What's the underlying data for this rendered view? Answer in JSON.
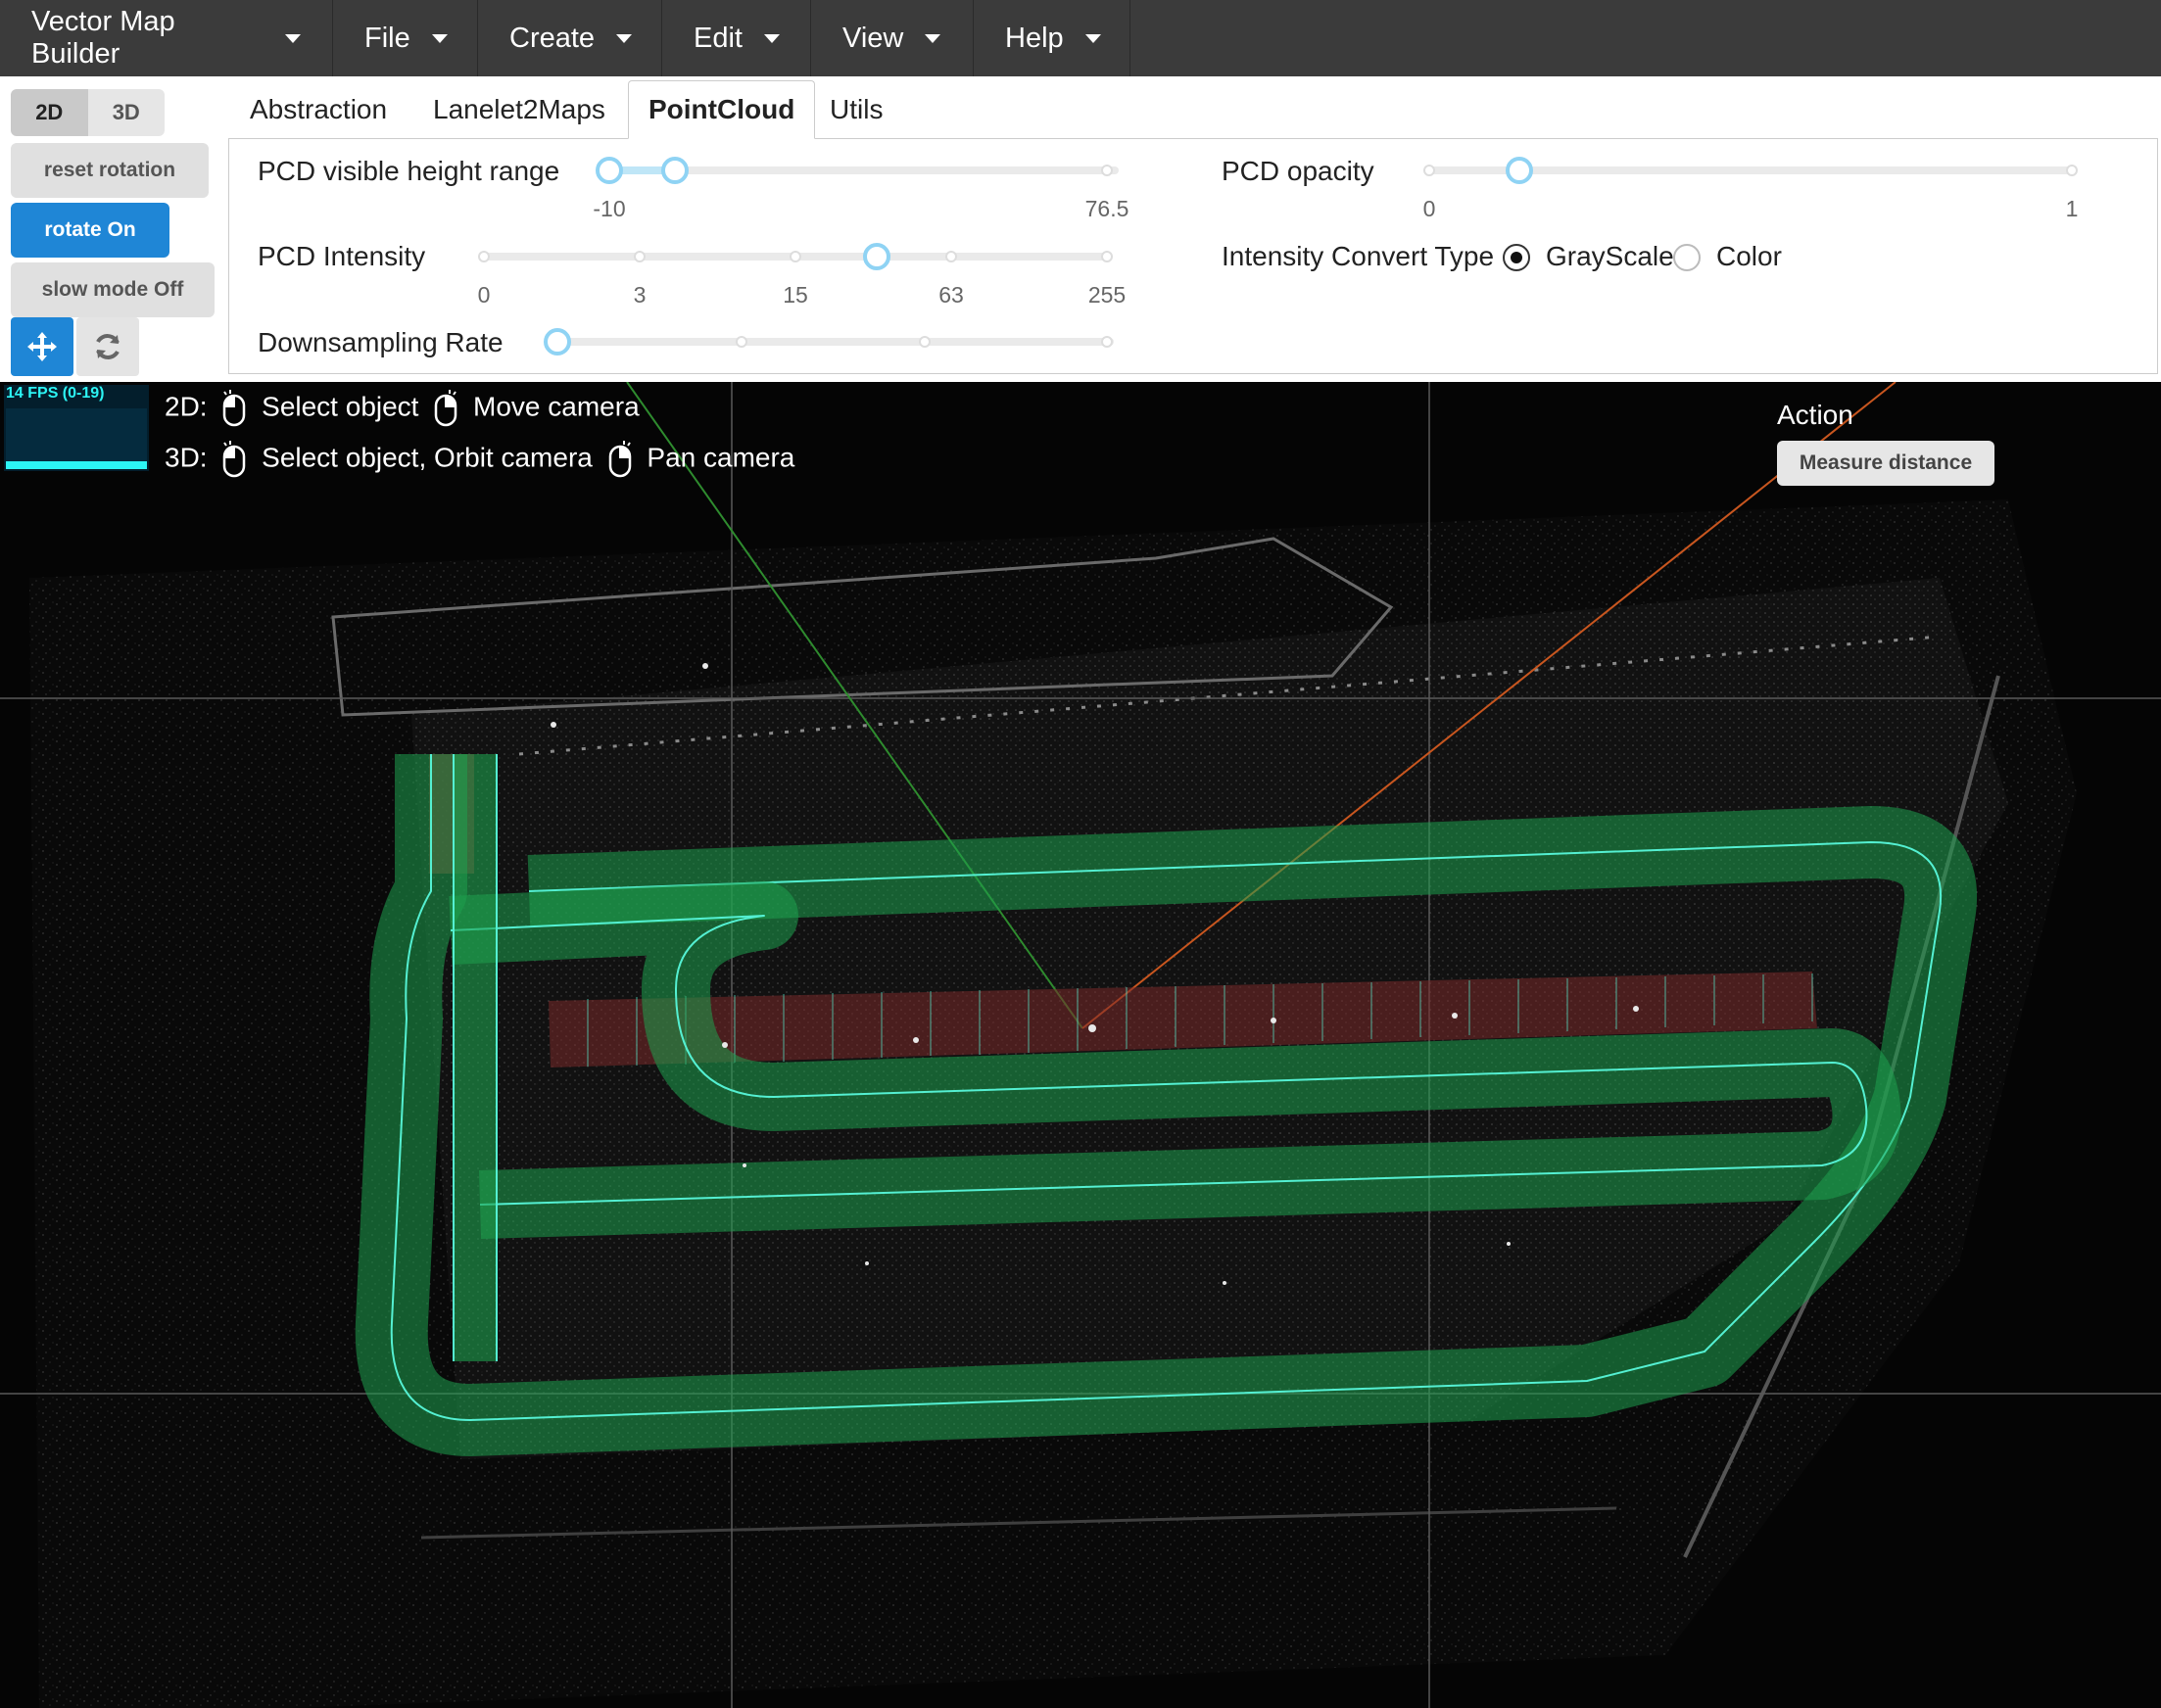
{
  "menubar": {
    "items": [
      {
        "label": "Vector Map Builder"
      },
      {
        "label": "File"
      },
      {
        "label": "Create"
      },
      {
        "label": "Edit"
      },
      {
        "label": "View"
      },
      {
        "label": "Help"
      }
    ]
  },
  "left_controls": {
    "view_2d": "2D",
    "view_3d": "3D",
    "active_view": "2D",
    "reset_rotation": "reset rotation",
    "rotate": "rotate On",
    "slow_mode": "slow mode Off",
    "move_tool_icon": "move-arrows-icon",
    "rotate_tool_icon": "rotate-icon"
  },
  "tabs": [
    {
      "label": "Abstraction",
      "active": false
    },
    {
      "label": "Lanelet2Maps",
      "active": false
    },
    {
      "label": "PointCloud",
      "active": true
    },
    {
      "label": "Utils",
      "active": false
    }
  ],
  "pointcloud": {
    "height_range": {
      "label": "PCD visible height range",
      "min_label": "-10",
      "max_label": "76.5",
      "low_fraction": 0.0,
      "high_fraction": 0.13
    },
    "opacity": {
      "label": "PCD opacity",
      "min_label": "0",
      "max_label": "1",
      "fraction": 0.14
    },
    "intensity": {
      "label": "PCD Intensity",
      "ticks": [
        "0",
        "3",
        "15",
        "63",
        "255"
      ],
      "fraction": 0.63
    },
    "intensity_convert": {
      "label": "Intensity Convert Type",
      "options": [
        "GrayScale",
        "Color"
      ],
      "selected": "GrayScale"
    },
    "downsampling": {
      "label": "Downsampling Rate",
      "fraction": 0.0
    }
  },
  "viewport": {
    "fps_text": "14 FPS (0-19)",
    "hint_2d_prefix": "2D:",
    "hint_2d_select": "Select object",
    "hint_2d_move": "Move camera",
    "hint_3d_prefix": "3D:",
    "hint_3d_select": "Select object, Orbit camera",
    "hint_3d_pan": "Pan camera",
    "action_label": "Action",
    "measure_button": "Measure distance",
    "colors": {
      "lane_fill": "#1ea04e",
      "lane_edge": "#54f0d2",
      "crosswalk": "#7a2a2a",
      "axis_green": "#2e8b2e",
      "axis_orange": "#c8561f",
      "grid": "#5a5a5a"
    }
  }
}
